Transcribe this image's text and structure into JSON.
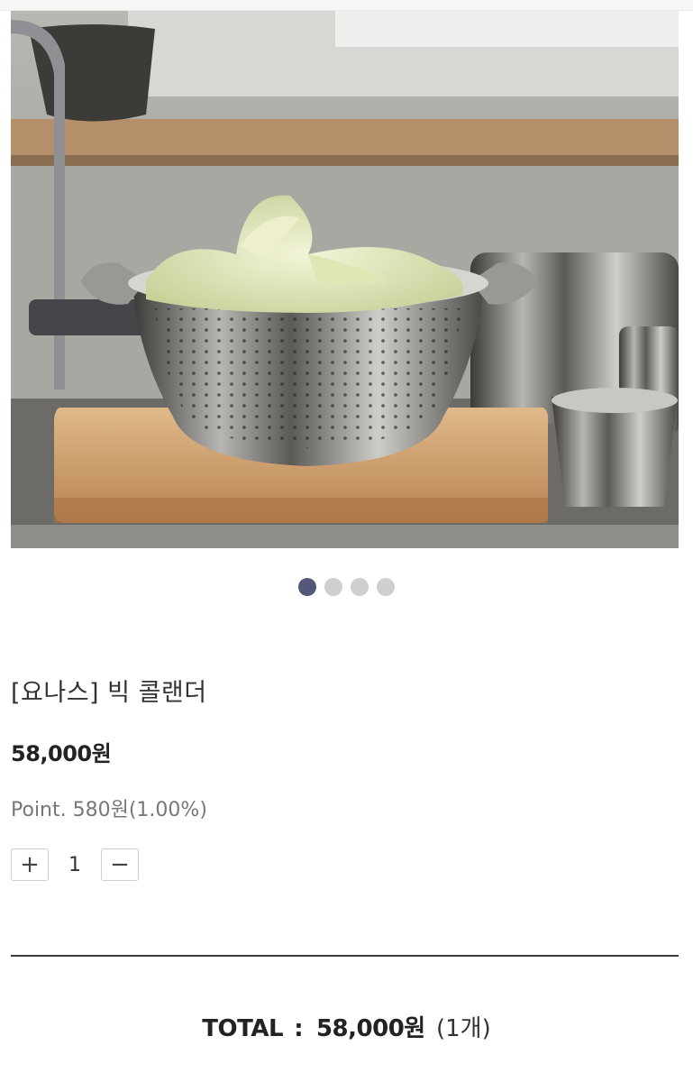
{
  "product": {
    "name": "[요나스] 빅 콜랜더",
    "price": "58,000원",
    "point": "Point. 580원(1.00%)",
    "image_description_icon": "colander-photo"
  },
  "carousel": {
    "total_slides": 4,
    "active_index": 0
  },
  "quantity": {
    "plus_label": "+",
    "value": "1",
    "minus_label": "−"
  },
  "total": {
    "label": "TOTAL",
    "separator": ":",
    "amount": "58,000원",
    "count": "(1개)"
  },
  "colors": {
    "dot_active": "#545878",
    "dot_inactive": "#cfcfcf",
    "divider": "#3a3a3a"
  }
}
